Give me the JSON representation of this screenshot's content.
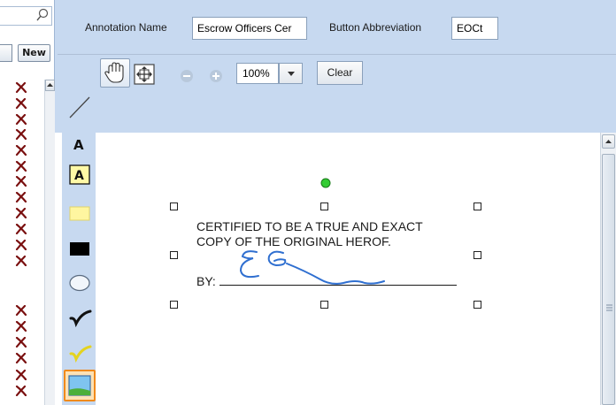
{
  "search": {
    "placeholder": ""
  },
  "list": {
    "new_label": "New",
    "delete_icon": "x-delete-icon",
    "rows": 17
  },
  "header": {
    "annotation_name_label": "Annotation Name",
    "annotation_name_value": "Escrow Officers Cer",
    "button_abbrev_label": "Button Abbreviation",
    "button_abbrev_value": "EOCt"
  },
  "toolbar": {
    "tools": [
      "pointer-icon",
      "hand-pan-icon",
      "fit-page-icon",
      "zoom-out-icon",
      "zoom-in-icon"
    ],
    "zoom_value": "100%",
    "clear_label": "Clear"
  },
  "side_tools": [
    "line-tool-icon",
    "text-tool-icon",
    "boxed-text-tool-icon",
    "highlight-tool-icon",
    "redact-tool-icon",
    "ellipse-tool-icon",
    "checkmark-tool-icon",
    "highlight-checkmark-tool-icon",
    "image-tool-icon"
  ],
  "stamp": {
    "line1": "CERTIFIED TO BE A TRUE AND EXACT",
    "line2": "COPY OF THE ORIGINAL HEROF.",
    "by_label": "BY:"
  },
  "colors": {
    "panel_blue": "#c7d9f0",
    "delete_red": "#7a1010",
    "rotate_handle": "#33cc33",
    "signature_blue": "#2f6fd0",
    "image_tool_border": "#f08a1c"
  }
}
